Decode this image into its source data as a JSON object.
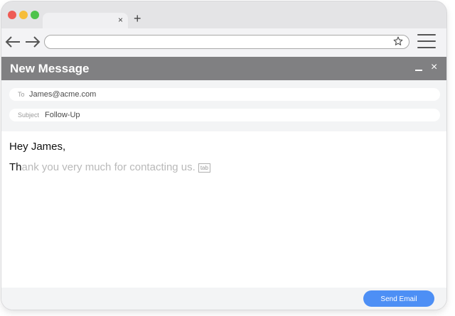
{
  "browser": {
    "tab_close_glyph": "×",
    "new_tab_glyph": "+",
    "url": "",
    "icons": {
      "back": "arrow-left-icon",
      "forward": "arrow-right-icon",
      "bookmark": "star-icon",
      "menu": "hamburger-menu-icon"
    }
  },
  "compose": {
    "title": "New Message",
    "close_glyph": "×",
    "to_label": "To",
    "to_value": "James@acme.com",
    "subject_label": "Subject",
    "subject_value": "Follow-Up",
    "greeting": "Hey James,",
    "typed_text": "Th",
    "suggestion_text": "ank you very much for contacting us.",
    "tab_hint": "tab",
    "send_label": "Send Email"
  },
  "colors": {
    "header": "#808082",
    "send_button": "#4d8ff5",
    "suggestion": "#b9b9b9"
  }
}
